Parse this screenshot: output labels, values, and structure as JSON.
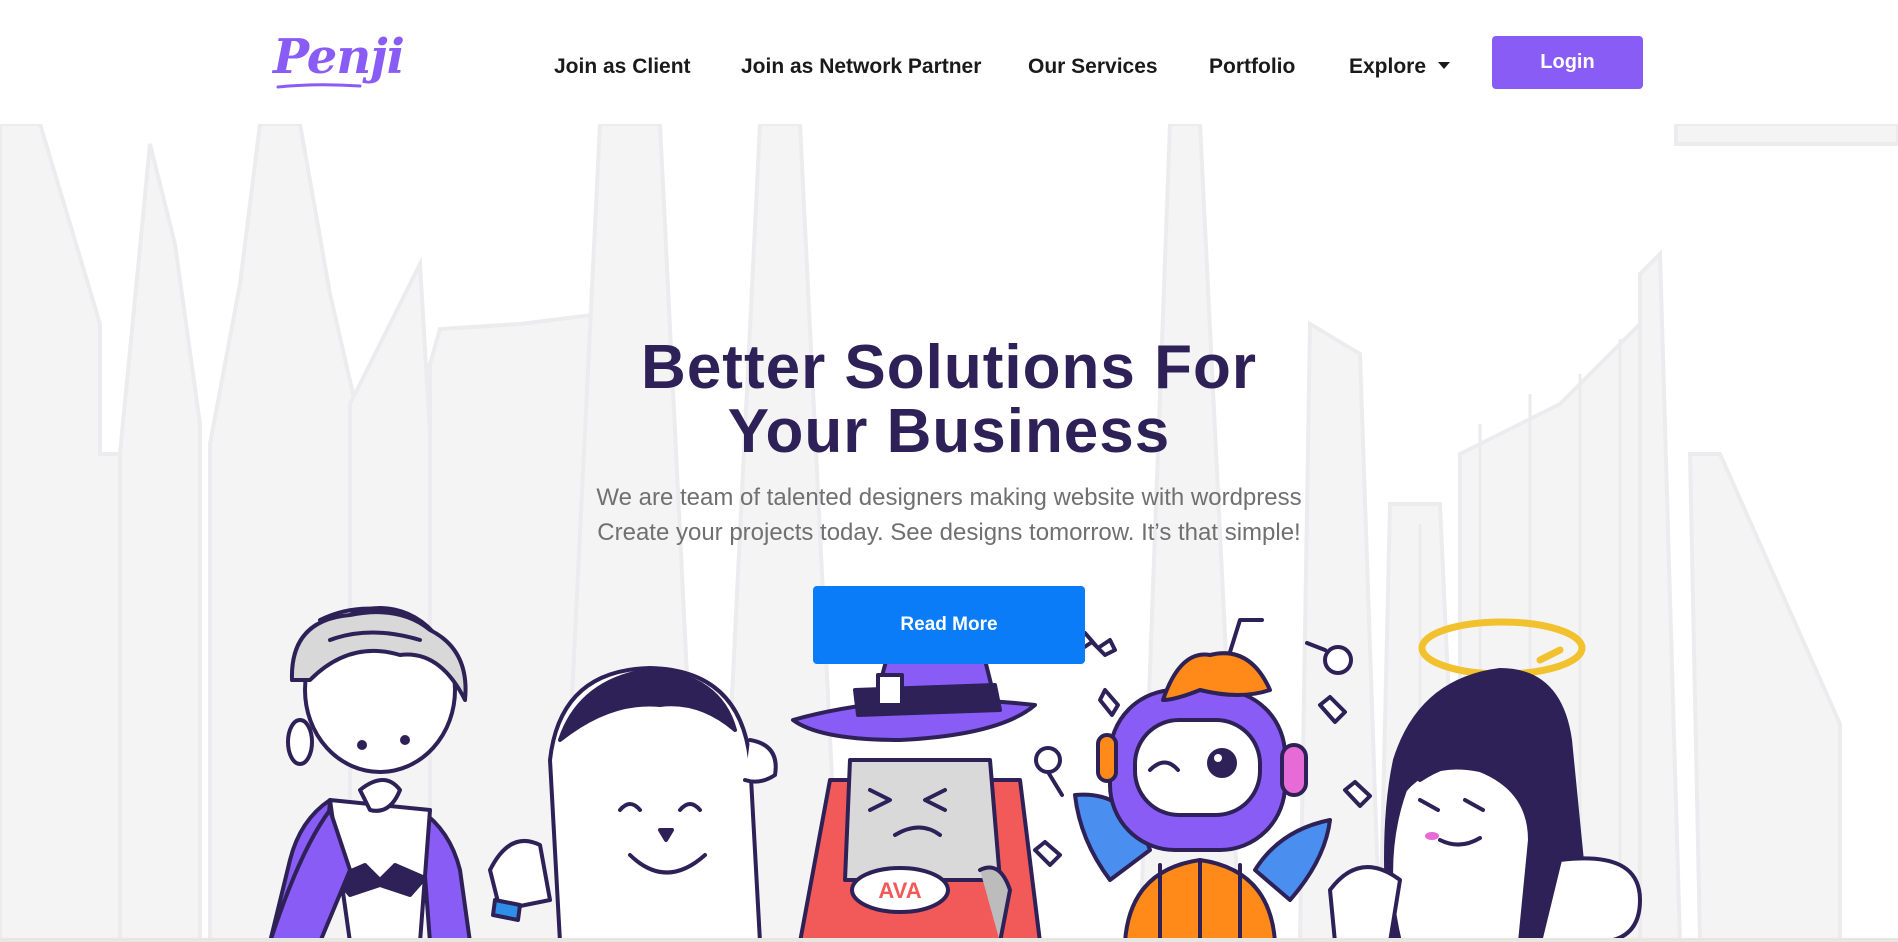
{
  "brand": {
    "logo_text": "Penji",
    "accent": "#8a5cf6"
  },
  "nav": {
    "items": [
      {
        "label": "Join as Client"
      },
      {
        "label": "Join as Network Partner"
      },
      {
        "label": "Our Services"
      },
      {
        "label": "Portfolio"
      },
      {
        "label": "Explore",
        "has_dropdown": true
      }
    ],
    "login_label": "Login"
  },
  "hero": {
    "title_line1": "Better Solutions For",
    "title_line2": "Your Business",
    "subtitle_line1": "We are team of talented designers making website with wordpress",
    "subtitle_line2": "Create your projects today. See designs tomorrow. It’s that simple!",
    "cta_label": "Read More",
    "title_color": "#2e2157",
    "cta_color": "#0a7cf7"
  },
  "illustration": {
    "characters": [
      "vampire",
      "yeti",
      "witch",
      "pumpkin-robot",
      "angel"
    ],
    "badge_text": "AVA"
  }
}
